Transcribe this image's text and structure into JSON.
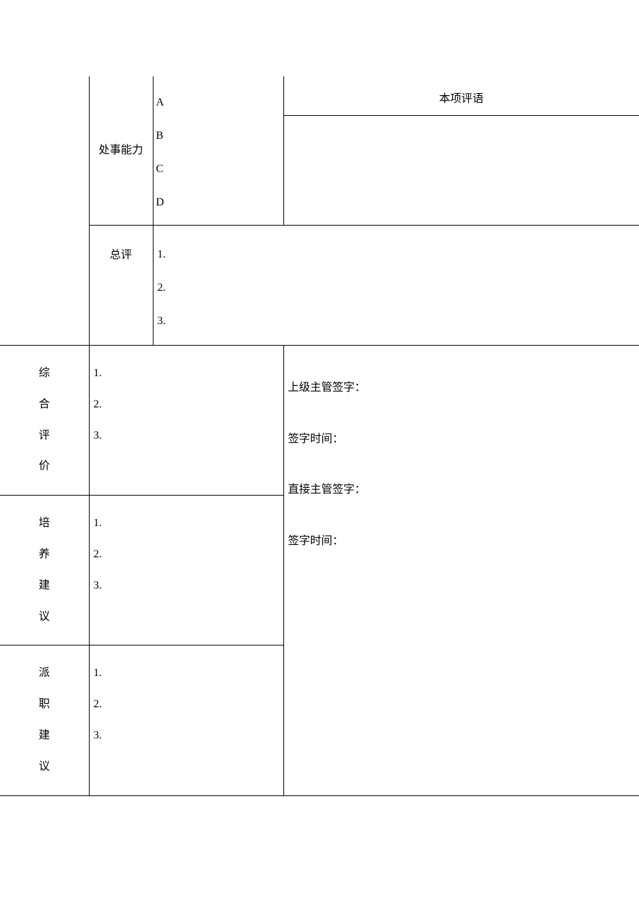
{
  "row1": {
    "sub_label": "处事能力",
    "options": {
      "a": "A",
      "b": "B",
      "c": "C",
      "d": "D"
    },
    "comment_header": "本项评语"
  },
  "row2": {
    "sub_label": "总评",
    "nums": {
      "n1": "1.",
      "n2": "2.",
      "n3": "3."
    }
  },
  "row3": {
    "cat": {
      "c1": "综",
      "c2": "合",
      "c3": "评",
      "c4": "价"
    },
    "nums": {
      "n1": "1.",
      "n2": "2.",
      "n3": "3."
    }
  },
  "row4": {
    "cat": {
      "c1": "培",
      "c2": "养",
      "c3": "建",
      "c4": "议"
    },
    "nums": {
      "n1": "1.",
      "n2": "2.",
      "n3": "3."
    }
  },
  "row5": {
    "cat": {
      "c1": "派",
      "c2": "职",
      "c3": "建",
      "c4": "议"
    },
    "nums": {
      "n1": "1.",
      "n2": "2.",
      "n3": "3."
    }
  },
  "sign": {
    "l1": "上级主管签字：",
    "l2": "签字时间：",
    "l3": "直接主管签字：",
    "l4": "签字时间："
  }
}
